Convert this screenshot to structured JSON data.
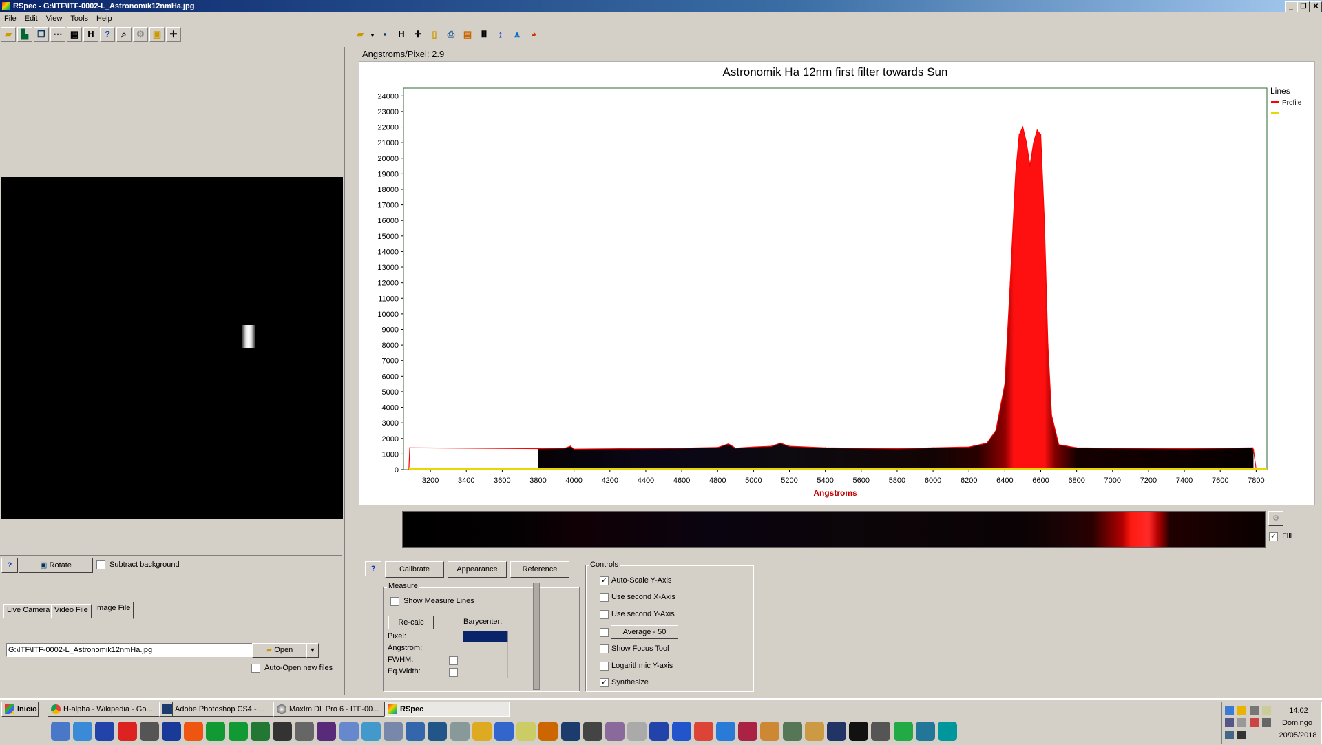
{
  "window": {
    "title": "RSpec - G:\\ITF\\ITF-0002-L_Astronomik12nmHa.jpg"
  },
  "menu": {
    "file": "File",
    "edit": "Edit",
    "view": "View",
    "tools": "Tools",
    "help": "Help"
  },
  "left": {
    "rotate_label": "Rotate",
    "subtract_label": "Subtract background",
    "subtract_checked": false,
    "tabs": [
      "Live Camera",
      "Video File",
      "Image File"
    ],
    "file_path": "G:\\ITF\\ITF-0002-L_Astronomik12nmHa.jpg",
    "open_label": "Open",
    "autoopen_label": "Auto-Open new files"
  },
  "right": {
    "ratio_text": "Angstroms/Pixel: 2.9",
    "fill_label": "Fill",
    "buttons": {
      "calibrate": "Calibrate",
      "appearance": "Appearance",
      "reference": "Reference"
    },
    "measure": {
      "group": "Measure",
      "show_lines": "Show Measure Lines",
      "recalc": "Re-calc",
      "barycenter": "Barycenter:",
      "pixel": "Pixel:",
      "angstrom": "Angstrom:",
      "fwhm": "FWHM:",
      "eqwidth": "Eq.Width:"
    },
    "controls": {
      "group": "Controls",
      "autoscale": "Auto-Scale Y-Axis",
      "second_x": "Use second X-Axis",
      "second_y": "Use second Y-Axis",
      "average": "Average - 50",
      "focus": "Show Focus Tool",
      "log_y": "Logarithmic Y-axis",
      "synthesize": "Synthesize"
    }
  },
  "chart_data": {
    "type": "area",
    "title": "Astronomik Ha 12nm first filter towards Sun",
    "xlabel": "Angstroms",
    "ylabel": "",
    "xlim": [
      3050,
      7860
    ],
    "ylim": [
      0,
      24500
    ],
    "xticks": [
      3200,
      3400,
      3600,
      3800,
      4000,
      4200,
      4400,
      4600,
      4800,
      5000,
      5200,
      5400,
      5600,
      5800,
      6000,
      6200,
      6400,
      6600,
      6800,
      7000,
      7200,
      7400,
      7600,
      7800
    ],
    "yticks": [
      0,
      1000,
      2000,
      3000,
      4000,
      5000,
      6000,
      7000,
      8000,
      9000,
      10000,
      11000,
      12000,
      13000,
      14000,
      15000,
      16000,
      17000,
      18000,
      19000,
      20000,
      21000,
      22000,
      23000,
      24000
    ],
    "legend": {
      "title": "Lines",
      "entries": [
        "Profile"
      ],
      "position": "right"
    },
    "grid": false,
    "series": [
      {
        "name": "Profile",
        "color": "#ff0000",
        "x": [
          3080,
          3085,
          3800,
          3801,
          3950,
          3980,
          4000,
          4300,
          4600,
          4800,
          4860,
          4900,
          5000,
          5100,
          5150,
          5200,
          5400,
          5800,
          6000,
          6200,
          6300,
          6350,
          6400,
          6430,
          6460,
          6480,
          6500,
          6520,
          6540,
          6560,
          6580,
          6600,
          6620,
          6640,
          6660,
          6700,
          6800,
          7000,
          7400,
          7780,
          7785,
          7800
        ],
        "y": [
          0,
          1400,
          1350,
          1350,
          1380,
          1500,
          1320,
          1350,
          1380,
          1420,
          1650,
          1380,
          1450,
          1500,
          1700,
          1500,
          1400,
          1350,
          1400,
          1450,
          1700,
          2500,
          5500,
          12000,
          19000,
          21500,
          22000,
          21000,
          19500,
          21000,
          21800,
          21500,
          16000,
          8000,
          3500,
          1600,
          1400,
          1380,
          1350,
          1400,
          1300,
          0
        ]
      }
    ]
  },
  "taskbar": {
    "start": "Inicio",
    "tasks": [
      "H-alpha - Wikipedia - Go...",
      "Adobe Photoshop CS4 - ...",
      "MaxIm DL Pro 6 - ITF-00...",
      "RSpec"
    ],
    "time": "14:02",
    "day": "Domingo",
    "date": "20/05/2018",
    "quick_icons": [
      "windows-icon",
      "refresh-icon",
      "sscro-icon",
      "winstars-icon",
      "satellite-icon",
      "stellarium-icon",
      "play-icon",
      "bowtie-icon",
      "bowtie2-icon",
      "phd-icon",
      "focus-icon",
      "moon-icon",
      "lock-icon",
      "box-icon",
      "book-icon",
      "calculator-icon",
      "vb-icon",
      "info-icon",
      "disc-icon",
      "compass-icon",
      "media-icon",
      "tools-icon",
      "bridge-icon",
      "photoshop-icon",
      "camera-icon",
      "tube-icon",
      "satellite2-icon",
      "telescope-icon",
      "globe-icon",
      "chrome-icon",
      "ie-icon",
      "galaxy-icon",
      "chart-icon",
      "monitor-icon",
      "glasses-icon",
      "spectrum-icon",
      "fan-icon",
      "terminal-icon",
      "shield-icon",
      "pycharm-icon",
      "arduino-icon"
    ]
  }
}
